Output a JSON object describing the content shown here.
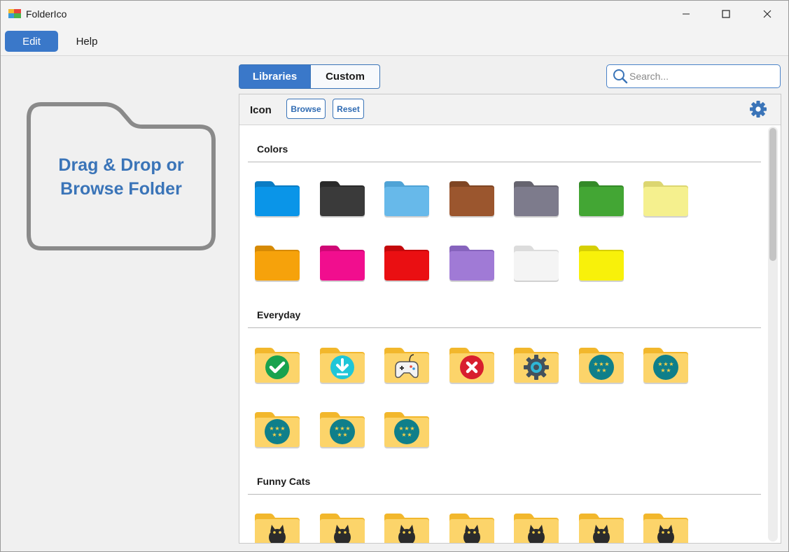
{
  "app": {
    "title": "FolderIco"
  },
  "menu": {
    "edit": "Edit",
    "help": "Help"
  },
  "dropzone": {
    "line1": "Drag & Drop or",
    "line2": "Browse Folder"
  },
  "tabs": [
    {
      "label": "Libraries",
      "active": true
    },
    {
      "label": "Custom",
      "active": false
    }
  ],
  "search": {
    "placeholder": "Search..."
  },
  "panel": {
    "header": {
      "label": "Icon",
      "browse": "Browse",
      "reset": "Reset"
    },
    "sections": [
      {
        "title": "Colors",
        "icons": [
          {
            "name": "blue-folder",
            "color": "#0a95e8",
            "tab": "#0a7cc4"
          },
          {
            "name": "black-folder",
            "color": "#3a3a3a",
            "tab": "#2a2a2a"
          },
          {
            "name": "light-blue-folder",
            "color": "#67b9ea",
            "tab": "#4fa3d6"
          },
          {
            "name": "brown-folder",
            "color": "#9b562e",
            "tab": "#7f4523"
          },
          {
            "name": "gray-folder",
            "color": "#7d7b8c",
            "tab": "#66646f"
          },
          {
            "name": "green-folder",
            "color": "#43a634",
            "tab": "#348a28"
          },
          {
            "name": "light-yellow-folder",
            "color": "#f5f08e",
            "tab": "#dcd670"
          },
          {
            "name": "orange-folder",
            "color": "#f6a20b",
            "tab": "#d68a05"
          },
          {
            "name": "pink-folder",
            "color": "#f10e8e",
            "tab": "#cf0775"
          },
          {
            "name": "red-folder",
            "color": "#ea0f12",
            "tab": "#c4080b"
          },
          {
            "name": "purple-folder",
            "color": "#a07ad6",
            "tab": "#8663bd"
          },
          {
            "name": "white-folder",
            "color": "#f4f4f4",
            "tab": "#dcdcdc"
          },
          {
            "name": "yellow-folder",
            "color": "#f8f10a",
            "tab": "#d6cf05"
          }
        ]
      },
      {
        "title": "Everyday",
        "icons": [
          {
            "name": "check-folder",
            "badge": "check"
          },
          {
            "name": "download-folder",
            "badge": "download"
          },
          {
            "name": "gamepad-folder",
            "badge": "gamepad"
          },
          {
            "name": "close-folder",
            "badge": "close"
          },
          {
            "name": "settings-folder",
            "badge": "gear"
          },
          {
            "name": "rating-folder-1",
            "badge": "stars"
          },
          {
            "name": "rating-folder-2",
            "badge": "stars"
          },
          {
            "name": "rating-folder-3",
            "badge": "stars"
          },
          {
            "name": "rating-folder-4",
            "badge": "stars"
          },
          {
            "name": "rating-folder-5",
            "badge": "stars"
          }
        ]
      },
      {
        "title": "Funny Cats",
        "icons": [
          {
            "name": "cat-folder-1",
            "badge": "cat"
          },
          {
            "name": "cat-folder-2",
            "badge": "cat"
          },
          {
            "name": "cat-folder-3",
            "badge": "cat"
          },
          {
            "name": "cat-folder-4",
            "badge": "cat"
          },
          {
            "name": "cat-folder-5",
            "badge": "cat"
          },
          {
            "name": "cat-folder-6",
            "badge": "cat"
          },
          {
            "name": "cat-folder-7",
            "badge": "cat"
          }
        ]
      }
    ]
  },
  "colors": {
    "accent": "#3a78c9",
    "text_accent": "#3a74b8",
    "dropzone_border": "#8a8a8a",
    "folder_yellow": "#fcd46a",
    "folder_yellow_tab": "#f2b72c"
  },
  "icons": {
    "minimize": "minimize-icon",
    "maximize": "maximize-icon",
    "close": "close-icon",
    "search": "search-icon",
    "settings": "gear-icon"
  }
}
